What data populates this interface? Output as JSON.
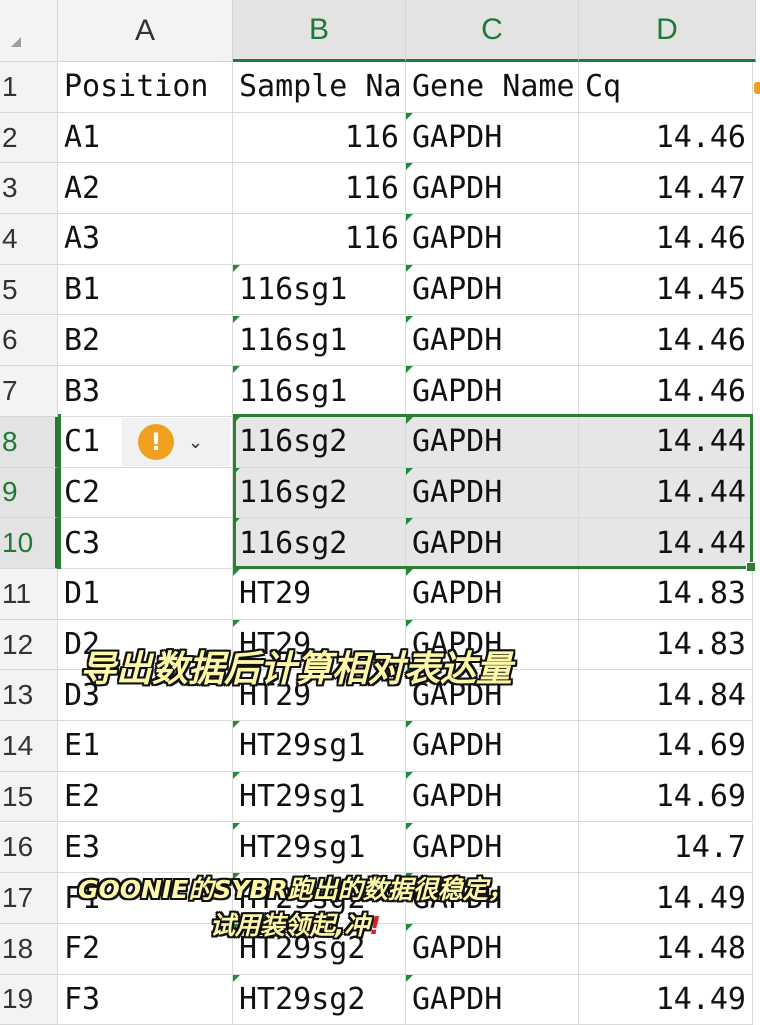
{
  "columns": [
    "A",
    "B",
    "C",
    "D"
  ],
  "selected_columns": [
    "B",
    "C",
    "D"
  ],
  "header": [
    "Position",
    "Sample Na",
    "Gene Name",
    "Cq"
  ],
  "rows": [
    {
      "num": "2",
      "pos": "A1",
      "sample": "116",
      "gene": "GAPDH",
      "cq": "14.46"
    },
    {
      "num": "3",
      "pos": "A2",
      "sample": "116",
      "gene": "GAPDH",
      "cq": "14.47"
    },
    {
      "num": "4",
      "pos": "A3",
      "sample": "116",
      "gene": "GAPDH",
      "cq": "14.46"
    },
    {
      "num": "5",
      "pos": "B1",
      "sample": "116sg1",
      "gene": "GAPDH",
      "cq": "14.45"
    },
    {
      "num": "6",
      "pos": "B2",
      "sample": "116sg1",
      "gene": "GAPDH",
      "cq": "14.46"
    },
    {
      "num": "7",
      "pos": "B3",
      "sample": "116sg1",
      "gene": "GAPDH",
      "cq": "14.46"
    },
    {
      "num": "8",
      "pos": "C1",
      "sample": "116sg2",
      "gene": "GAPDH",
      "cq": "14.44"
    },
    {
      "num": "9",
      "pos": "C2",
      "sample": "116sg2",
      "gene": "GAPDH",
      "cq": "14.44"
    },
    {
      "num": "10",
      "pos": "C3",
      "sample": "116sg2",
      "gene": "GAPDH",
      "cq": "14.44"
    },
    {
      "num": "11",
      "pos": "D1",
      "sample": "HT29",
      "gene": "GAPDH",
      "cq": "14.83"
    },
    {
      "num": "12",
      "pos": "D2",
      "sample": "HT29",
      "gene": "GAPDH",
      "cq": "14.83"
    },
    {
      "num": "13",
      "pos": "D3",
      "sample": "HT29",
      "gene": "GAPDH",
      "cq": "14.84"
    },
    {
      "num": "14",
      "pos": "E1",
      "sample": "HT29sg1",
      "gene": "GAPDH",
      "cq": "14.69"
    },
    {
      "num": "15",
      "pos": "E2",
      "sample": "HT29sg1",
      "gene": "GAPDH",
      "cq": "14.69"
    },
    {
      "num": "16",
      "pos": "E3",
      "sample": "HT29sg1",
      "gene": "GAPDH",
      "cq": "14.7"
    },
    {
      "num": "17",
      "pos": "F1",
      "sample": "HT29sg2",
      "gene": "GAPDH",
      "cq": "14.49"
    },
    {
      "num": "18",
      "pos": "F2",
      "sample": "HT29sg2",
      "gene": "GAPDH",
      "cq": "14.48"
    },
    {
      "num": "19",
      "pos": "F3",
      "sample": "HT29sg2",
      "gene": "GAPDH",
      "cq": "14.49"
    }
  ],
  "selected_rows": [
    "8",
    "9",
    "10"
  ],
  "warning_icon": "exclamation-circle-icon",
  "captions": {
    "main": "导出数据后计算相对表达量",
    "sub_line1": "GOONIE的SYBR跑出的数据很稳定，",
    "sub_line2": "试用装领起,冲",
    "sub_mark": "!"
  },
  "colors": {
    "accent": "#1e7a34",
    "warning": "#f0a020",
    "caption": "#fff8a8"
  }
}
